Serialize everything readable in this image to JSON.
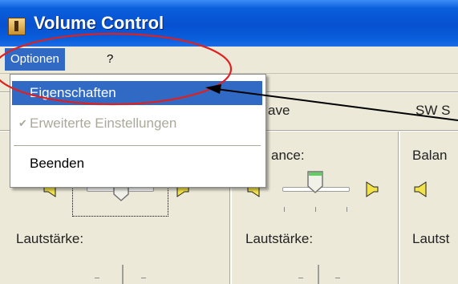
{
  "window": {
    "title": "Volume Control"
  },
  "menu": {
    "items": [
      {
        "label": "Optionen"
      },
      {
        "label": "?"
      }
    ]
  },
  "dropdown": {
    "items": [
      {
        "label": "Eigenschaften",
        "selected": true
      },
      {
        "label": "Erweiterte Einstellungen",
        "disabled": true,
        "checked": true
      },
      {
        "label": "Beenden"
      }
    ]
  },
  "panels": [
    {
      "header": "ave",
      "balance_label": "ance:",
      "volume_label": "Lautstärke:"
    },
    {
      "header": "SW S",
      "balance_label": "Balan",
      "volume_label": "Lautst"
    }
  ],
  "main_panel": {
    "volume_label": "Lautstärke:"
  },
  "colors": {
    "accent": "#316ac5",
    "annotation": "#e0201f",
    "titlebar": "#0751d0"
  },
  "icons": [
    "speaker-left-icon",
    "speaker-right-icon",
    "window-app-icon",
    "check-icon"
  ]
}
